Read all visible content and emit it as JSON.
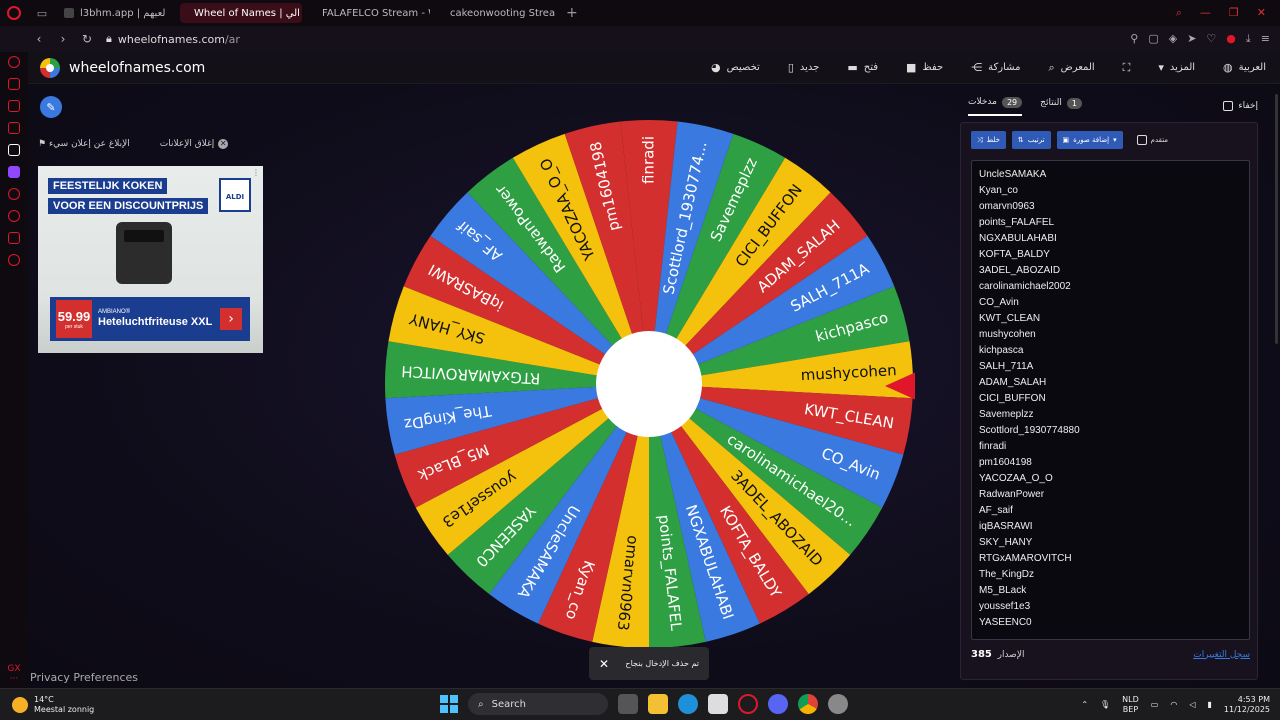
{
  "browser": {
    "tabs": [
      {
        "label": "l3bhm.app | لعبهم",
        "active": false
      },
      {
        "label": "Wheel of Names | الي",
        "active": true
      },
      {
        "label": "FALAFELCO Stream - Wa",
        "active": false
      },
      {
        "label": "cakeonwooting Stream - \\",
        "active": false
      }
    ],
    "url_host": "wheelofnames.com",
    "url_path": "/ar"
  },
  "header": {
    "site_title": "wheelofnames.com",
    "menu": [
      {
        "label": "تخصيص",
        "icon": "palette-icon"
      },
      {
        "label": "جديد",
        "icon": "new-file-icon"
      },
      {
        "label": "فتح",
        "icon": "folder-icon"
      },
      {
        "label": "حفظ",
        "icon": "save-icon"
      },
      {
        "label": "مشاركة",
        "icon": "share-icon"
      },
      {
        "label": "المعرض",
        "icon": "search-icon"
      },
      {
        "label": "",
        "icon": "fullscreen-icon"
      },
      {
        "label": "المزيد",
        "icon": "chevron-down-icon"
      },
      {
        "label": "العربية",
        "icon": "globe-icon"
      }
    ]
  },
  "ads": {
    "close_label": "إغلاق الإعلانات",
    "report_label": "الإبلاغ عن إعلان سيء",
    "headline1": "FEESTELIJK KOKEN",
    "headline2": "VOOR EEN DISCOUNTPRIJS",
    "brand": "ALDI",
    "price": "59.99",
    "price_sub": "per stuk",
    "product_brand": "AMBIANO®",
    "product_name": "Heteluchtfriteuse XXL"
  },
  "privacy_label": "Privacy Preferences",
  "wheel": {
    "entries_clockwise_from_top": [
      "finradi",
      "Scottlord_1930774...",
      "Savemeplzz",
      "CICI_BUFFON",
      "ADAM_SALAH",
      "SALH_711A",
      "kichpasco",
      "mushycohen",
      "KWT_CLEAN",
      "CO_Avin",
      "carolinamichael20...",
      "3ADEL_ABOZAID",
      "KOFTA_BALDY",
      "NGXABULAHABI",
      "points_FALAFEL",
      "omarvn0963",
      "Kyan_co",
      "UncleSAMAKA",
      "YASEENC0",
      "youssef1e3",
      "M5_BLack",
      "The_KingDz",
      "RTGxAMAROVITCH",
      "SKY_HANY",
      "iqBASRAWI",
      "AF_saif",
      "RadwanPower",
      "YACOZAA_O_O",
      "pm1604198"
    ],
    "colors": [
      "#d32f2f",
      "#3a7ae0",
      "#2ea043",
      "#f4c20d"
    ],
    "pointer_color": "#e0162b"
  },
  "toast": {
    "message": "تم حذف الإدخال بنجاح"
  },
  "panel": {
    "tab_entries_label": "مدخلات",
    "tab_entries_count": "29",
    "tab_results_label": "النتائج",
    "tab_results_count": "1",
    "hide_label": "إخفاء",
    "shuffle_label": "خلط",
    "sort_label": "ترتيب",
    "add_image_label": "إضافة صورة",
    "advanced_label": "متقدم",
    "entries": [
      "UncleSAMAKA",
      "Kyan_co",
      "omarvn0963",
      "points_FALAFEL",
      "NGXABULAHABI",
      "KOFTA_BALDY",
      "3ADEL_ABOZAID",
      "carolinamichael2002",
      "CO_Avin",
      "KWT_CLEAN",
      "mushycohen",
      "kichpasca",
      "SALH_711A",
      "ADAM_SALAH",
      "CICI_BUFFON",
      "Savemeplzz",
      "Scottlord_1930774880",
      "finradi",
      "pm1604198",
      "YACOZAA_O_O",
      "RadwanPower",
      "AF_saif",
      "iqBASRAWI",
      "SKY_HANY",
      "RTGxAMAROVITCH",
      "The_KingDz",
      "M5_BLack",
      "youssef1e3",
      "YASEENC0"
    ],
    "version_label": "الإصدار",
    "version_number": "385",
    "changelog_label": "سجل التغييرات"
  },
  "taskbar": {
    "temp": "14°C",
    "weather": "Meestal zonnig",
    "search": "Search",
    "lang1": "NLD",
    "lang2": "BEP",
    "time": "4:53 PM",
    "date": "11/12/2025"
  }
}
